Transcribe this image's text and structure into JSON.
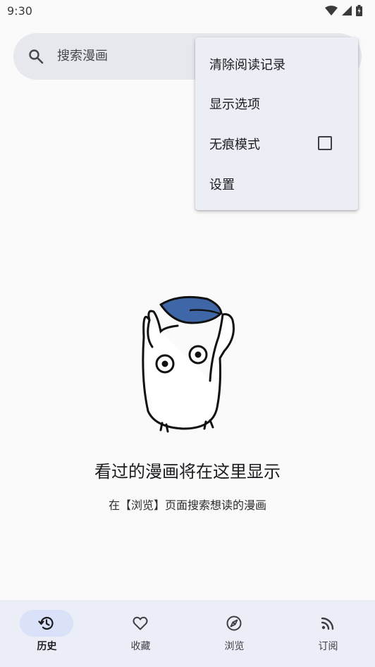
{
  "status_bar": {
    "time": "9:30"
  },
  "search": {
    "placeholder": "搜索漫画"
  },
  "menu": {
    "items": [
      {
        "label": "清除阅读记录"
      },
      {
        "label": "显示选项"
      },
      {
        "label": "无痕模式",
        "checked": false
      },
      {
        "label": "设置"
      }
    ]
  },
  "empty_state": {
    "title": "看过的漫画将在这里显示",
    "subtitle": "在【浏览】页面搜索想读的漫画"
  },
  "bottom_nav": {
    "items": [
      {
        "label": "历史",
        "icon": "history-icon",
        "active": true
      },
      {
        "label": "收藏",
        "icon": "heart-icon",
        "active": false
      },
      {
        "label": "浏览",
        "icon": "compass-icon",
        "active": false
      },
      {
        "label": "订阅",
        "icon": "rss-icon",
        "active": false
      }
    ]
  },
  "colors": {
    "background": "#fafafa",
    "search_bar": "#e7e8ee",
    "menu_bg": "#eceef6",
    "nav_bg": "#eceef7",
    "nav_active_pill": "#d9e2f8",
    "leaf": "#3f67a8"
  }
}
